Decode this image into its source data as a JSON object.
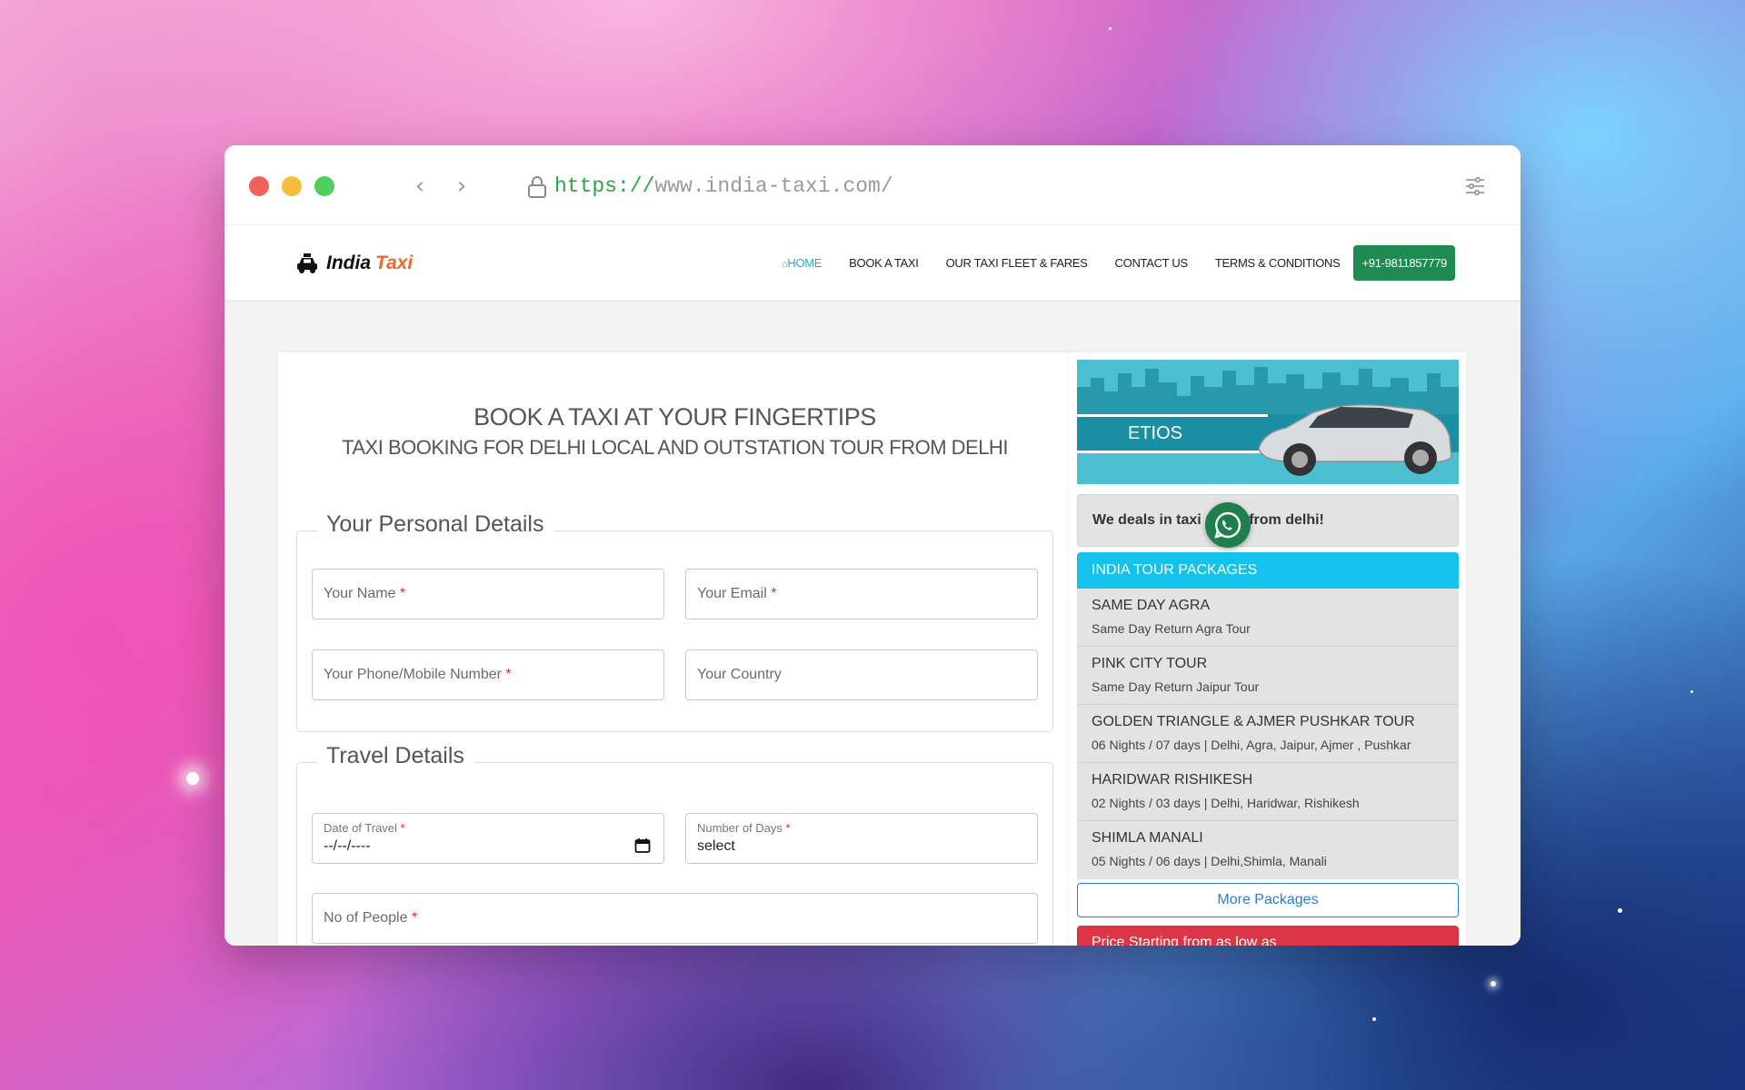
{
  "browser": {
    "url_protocol": "https://",
    "url_host": "www.india-taxi.com/"
  },
  "site": {
    "logo_text_1": "India",
    "logo_text_2": "Taxi",
    "nav": {
      "home": "HOME",
      "book": "BOOK A TAXI",
      "fleet": "OUR TAXI FLEET & FARES",
      "contact": "CONTACT US",
      "terms": "TERMS & CONDITIONS",
      "phone": "+91-9811857779"
    }
  },
  "form": {
    "heading": "BOOK A TAXI AT YOUR FINGERTIPS",
    "subheading": "TAXI BOOKING FOR DELHI LOCAL AND OUTSTATION TOUR FROM DELHI",
    "personal": {
      "legend": "Your Personal Details",
      "name_placeholder": "Your Name",
      "email_placeholder": "Your Email",
      "phone_placeholder": "Your Phone/Mobile Number",
      "country_placeholder": "Your Country"
    },
    "travel": {
      "legend": "Travel Details",
      "date_label": "Date of Travel",
      "date_value": "--/--/----",
      "days_label": "Number of Days",
      "days_value": "select",
      "people_placeholder": "No of People"
    },
    "required_mark": "*"
  },
  "sidebar": {
    "banner_text": "ETIOS",
    "deal_text": "We deals in taxi rental from delhi!",
    "packages_header": "INDIA TOUR PACKAGES",
    "packages": [
      {
        "title": "SAME DAY AGRA",
        "subtitle": "Same Day Return Agra Tour"
      },
      {
        "title": "PINK CITY TOUR",
        "subtitle": "Same Day Return Jaipur Tour"
      },
      {
        "title": "GOLDEN TRIANGLE & AJMER PUSHKAR TOUR",
        "subtitle": "06 Nights / 07 days | Delhi, Agra, Jaipur, Ajmer , Pushkar"
      },
      {
        "title": "HARIDWAR RISHIKESH",
        "subtitle": "02 Nights / 03 days | Delhi, Haridwar, Rishikesh"
      },
      {
        "title": "SHIMLA MANALI",
        "subtitle": "05 Nights / 06 days | Delhi,Shimla, Manali"
      }
    ],
    "more_label": "More Packages",
    "price_text": "Price Starting from as low as"
  },
  "colors": {
    "accent_green": "#1f8b52",
    "header_cyan": "#14c2ec",
    "price_red": "#dc3545",
    "link_blue": "#2d7bd4"
  }
}
